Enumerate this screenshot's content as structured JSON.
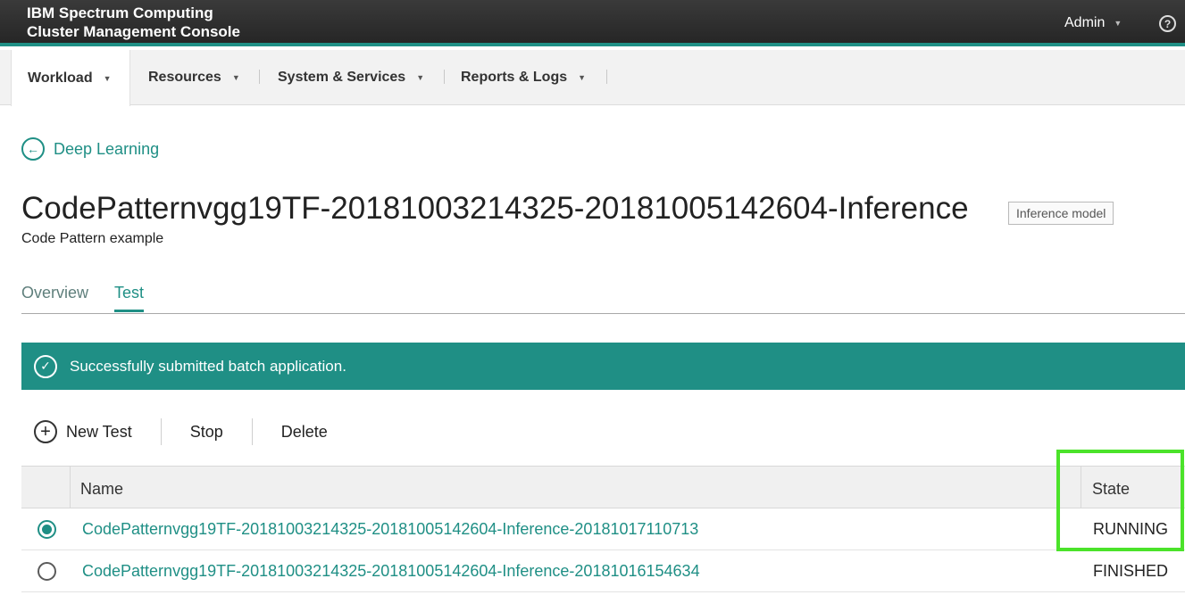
{
  "header": {
    "brand_line1": "IBM Spectrum Computing",
    "brand_line2": "Cluster Management Console",
    "user": "Admin",
    "help_icon": "question-circle-icon"
  },
  "nav": {
    "items": [
      {
        "label": "Workload",
        "active": true
      },
      {
        "label": "Resources",
        "active": false
      },
      {
        "label": "System & Services",
        "active": false
      },
      {
        "label": "Reports & Logs",
        "active": false
      }
    ]
  },
  "breadcrumb": {
    "back_label": "Deep Learning",
    "icon": "arrow-left-circle-icon"
  },
  "page": {
    "title": "CodePatternvgg19TF-20181003214325-20181005142604-Inference",
    "tag": "Inference model",
    "subtitle": "Code Pattern example"
  },
  "tabs": [
    {
      "label": "Overview",
      "active": false
    },
    {
      "label": "Test",
      "active": true
    }
  ],
  "notification": {
    "text": "Successfully submitted batch application.",
    "icon": "checkmark-circle-icon"
  },
  "toolbar": {
    "new_test": "New Test",
    "stop": "Stop",
    "delete": "Delete"
  },
  "table": {
    "columns": {
      "name": "Name",
      "state": "State"
    },
    "rows": [
      {
        "name": "CodePatternvgg19TF-20181003214325-20181005142604-Inference-20181017110713",
        "state": "RUNNING",
        "selected": true
      },
      {
        "name": "CodePatternvgg19TF-20181003214325-20181005142604-Inference-20181016154634",
        "state": "FINISHED",
        "selected": false
      }
    ]
  },
  "colors": {
    "accent": "#1f8f85",
    "highlight": "#4be32a",
    "header_bg": "#2e2e2e"
  }
}
